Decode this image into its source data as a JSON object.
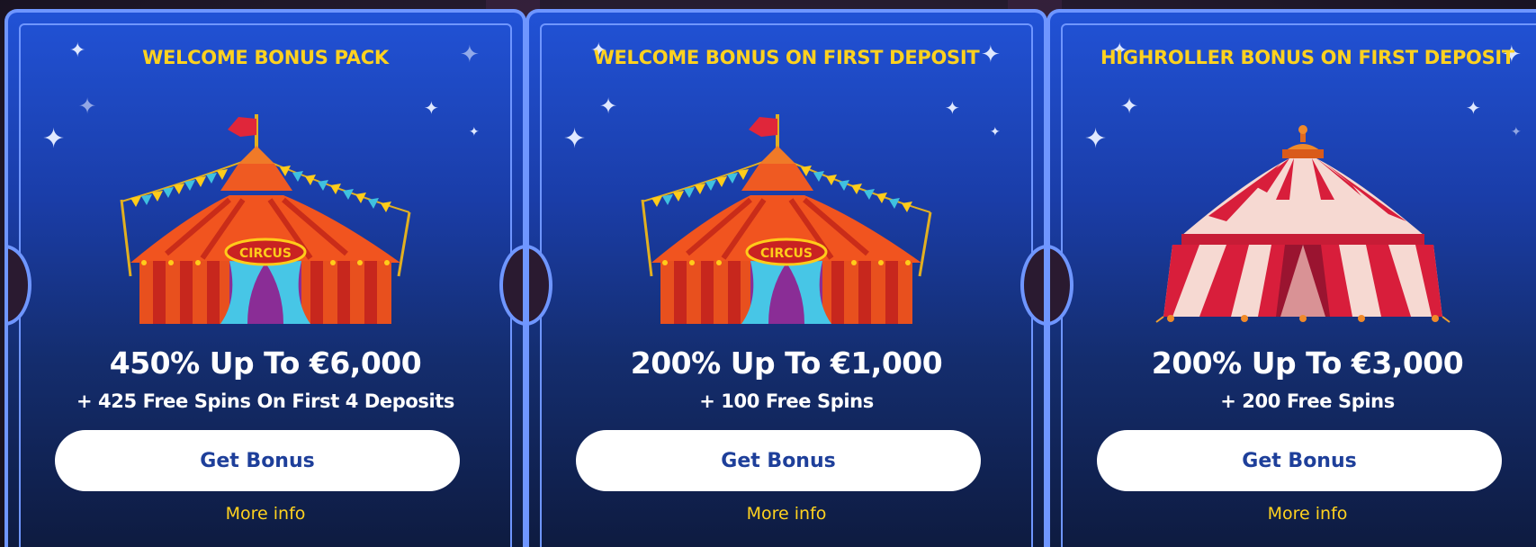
{
  "cards": [
    {
      "title": "WELCOME BONUS PACK",
      "headline": "450% Up To €6,000",
      "subline": "+ 425 Free Spins On First 4 Deposits",
      "button_label": "Get Bonus",
      "more_label": "More info",
      "image": "circus-tent-orange-icon"
    },
    {
      "title": "WELCOME BONUS ON FIRST DEPOSIT",
      "headline": "200% Up To €1,000",
      "subline": "+ 100 Free Spins",
      "button_label": "Get Bonus",
      "more_label": "More info",
      "image": "circus-tent-orange-icon"
    },
    {
      "title": "HIGHROLLER BONUS ON FIRST DEPOSIT",
      "headline": "200% Up To €3,000",
      "subline": "+ 200 Free Spins",
      "button_label": "Get Bonus",
      "more_label": "More info",
      "image": "circus-tent-red-white-icon"
    }
  ],
  "tent_sign": "CIRCUS",
  "colors": {
    "card_top": "#2152d6",
    "card_bottom": "#0e1b40",
    "border": "#6f96ff",
    "accent_yellow": "#ffd21f",
    "button_text": "#1e3f9a"
  }
}
